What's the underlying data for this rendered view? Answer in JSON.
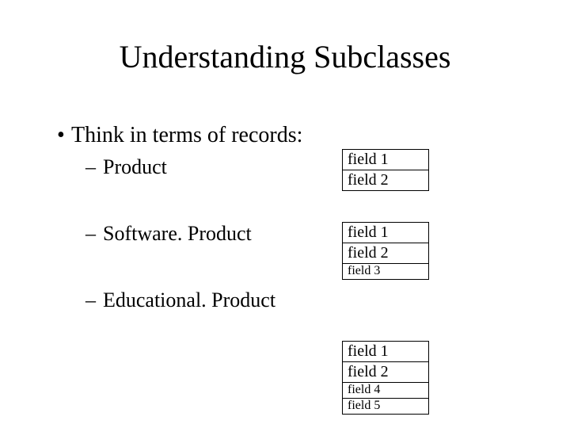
{
  "title": "Understanding Subclasses",
  "bullet": "Think in terms of records:",
  "subs": {
    "product": "Product",
    "software": "Software. Product",
    "educational": "Educational. Product"
  },
  "records": {
    "a": {
      "f1": "field 1",
      "f2": "field 2"
    },
    "b": {
      "f1": "field 1",
      "f2": "field 2",
      "f3": "field 3"
    },
    "c": {
      "f1": "field 1",
      "f2": "field 2",
      "f4": "field 4",
      "f5": "field 5"
    }
  },
  "glyphs": {
    "bullet": "•",
    "dash": "–"
  }
}
